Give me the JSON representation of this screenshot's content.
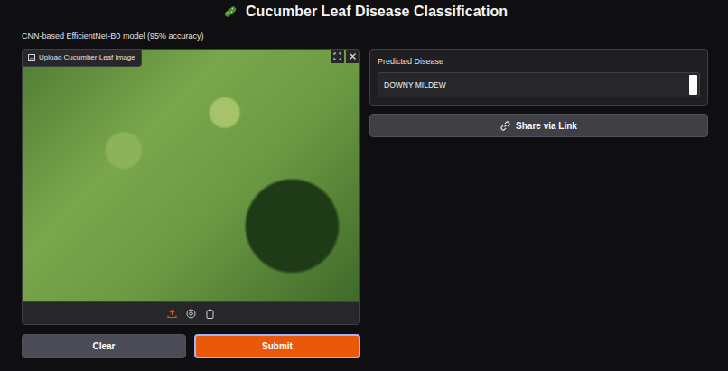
{
  "header": {
    "title": "Cucumber Leaf Disease Classification",
    "subtitle": "CNN-based EfficientNet-B0 model (95% accuracy)"
  },
  "image_input": {
    "label": "Upload Cucumber Leaf Image"
  },
  "buttons": [
    {
      "label": "Clear",
      "kind": "secondary"
    },
    {
      "label": "Submit",
      "kind": "primary"
    }
  ],
  "output": {
    "label": "Predicted Disease",
    "value": "DOWNY MILDEW"
  },
  "share_button": {
    "label": "Share via Link"
  }
}
